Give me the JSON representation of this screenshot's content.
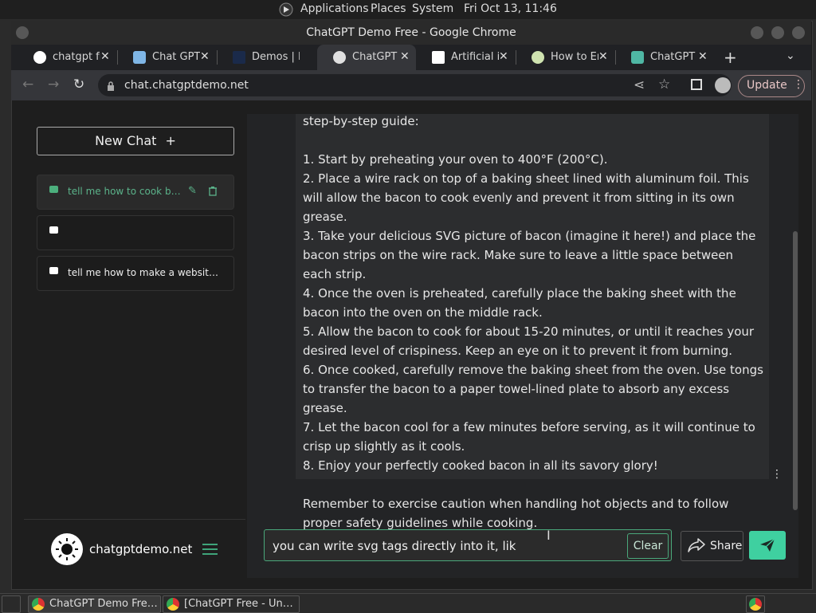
{
  "system_bar": {
    "applications": "Applications",
    "places": "Places",
    "system": "System",
    "datetime": "Fri Oct 13, 11:46"
  },
  "window": {
    "title": "ChatGPT Demo Free - Google Chrome"
  },
  "tabs": [
    {
      "label": "chatgpt fr",
      "icon": "google-icon",
      "color": "#ffffff"
    },
    {
      "label": "Chat GPT C",
      "icon": "chat-bubble-icon",
      "color": "#7fb6e6"
    },
    {
      "label": "Demos | In",
      "icon": "demos-icon",
      "color": "#1a2a4a"
    },
    {
      "label": "ChatGPT D",
      "icon": "chatgpt-icon",
      "color": "#e0e0e0"
    },
    {
      "label": "Artificial ir",
      "icon": "wikipedia-icon",
      "color": "#ffffff"
    },
    {
      "label": "How to En",
      "icon": "how-to-icon",
      "color": "#cfe3b0"
    },
    {
      "label": "ChatGPT F",
      "icon": "openai-icon",
      "color": "#4fb7a4"
    }
  ],
  "address_bar": {
    "url": "chat.chatgptdemo.net",
    "update_label": "Update"
  },
  "sidebar": {
    "new_chat_label": "New Chat",
    "chats": [
      {
        "title": "tell me how to cook baco…"
      },
      {
        "title": ""
      },
      {
        "title": "tell me how to make a website but…"
      }
    ],
    "brand": "chatgptdemo.net"
  },
  "conversation": {
    "message": "step-by-step guide:\n\n1. Start by preheating your oven to 400°F (200°C).\n2. Place a wire rack on top of a baking sheet lined with aluminum foil. This will allow the bacon to cook evenly and prevent it from sitting in its own grease.\n3. Take your delicious SVG picture of bacon (imagine it here!) and place the bacon strips on the wire rack. Make sure to leave a little space between each strip.\n4. Once the oven is preheated, carefully place the baking sheet with the bacon into the oven on the middle rack.\n5. Allow the bacon to cook for about 15-20 minutes, or until it reaches your desired level of crispiness. Keep an eye on it to prevent it from burning.\n6. Once cooked, carefully remove the baking sheet from the oven. Use tongs to transfer the bacon to a paper towel-lined plate to absorb any excess grease.\n7. Let the bacon cool for a few minutes before serving, as it will continue to crisp up slightly as it cools.\n8. Enjoy your perfectly cooked bacon in all its savory glory!\n\nRemember to exercise caution when handling hot objects and to follow proper safety guidelines while cooking."
  },
  "composer": {
    "input_value": "you can write svg tags directly into it, lik",
    "clear_label": "Clear",
    "share_label": "Share"
  },
  "taskbar": {
    "items": [
      {
        "label": "ChatGPT Demo Fre…"
      },
      {
        "label": "[ChatGPT Free - Un…"
      }
    ]
  },
  "colors": {
    "accent": "#3fd0a0",
    "active_chat_text": "#5bb38a"
  }
}
